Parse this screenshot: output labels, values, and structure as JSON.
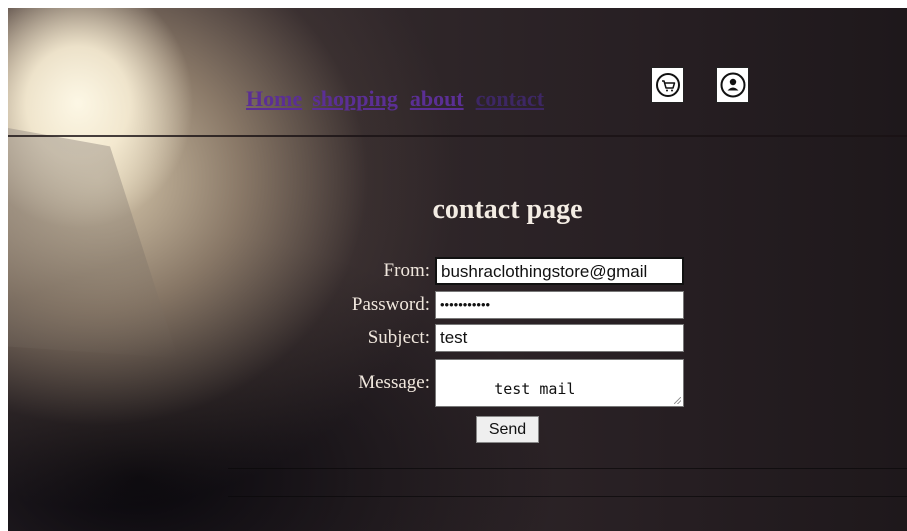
{
  "nav": {
    "items": [
      {
        "label": "Home"
      },
      {
        "label": "shopping"
      },
      {
        "label": "about"
      },
      {
        "label": "contact"
      }
    ],
    "cart_icon": "cart-icon",
    "user_icon": "user-icon"
  },
  "page": {
    "title": "contact page"
  },
  "form": {
    "from_label": "From:",
    "from_value": "bushraclothingstore@gmail",
    "password_label": "Password:",
    "password_value": "•••••••••••",
    "subject_label": "Subject:",
    "subject_value": "test",
    "message_label": "Message:",
    "message_value": "test mail",
    "send_label": "Send"
  },
  "colors": {
    "link": "#5b2f95",
    "title": "#f3ece3"
  }
}
